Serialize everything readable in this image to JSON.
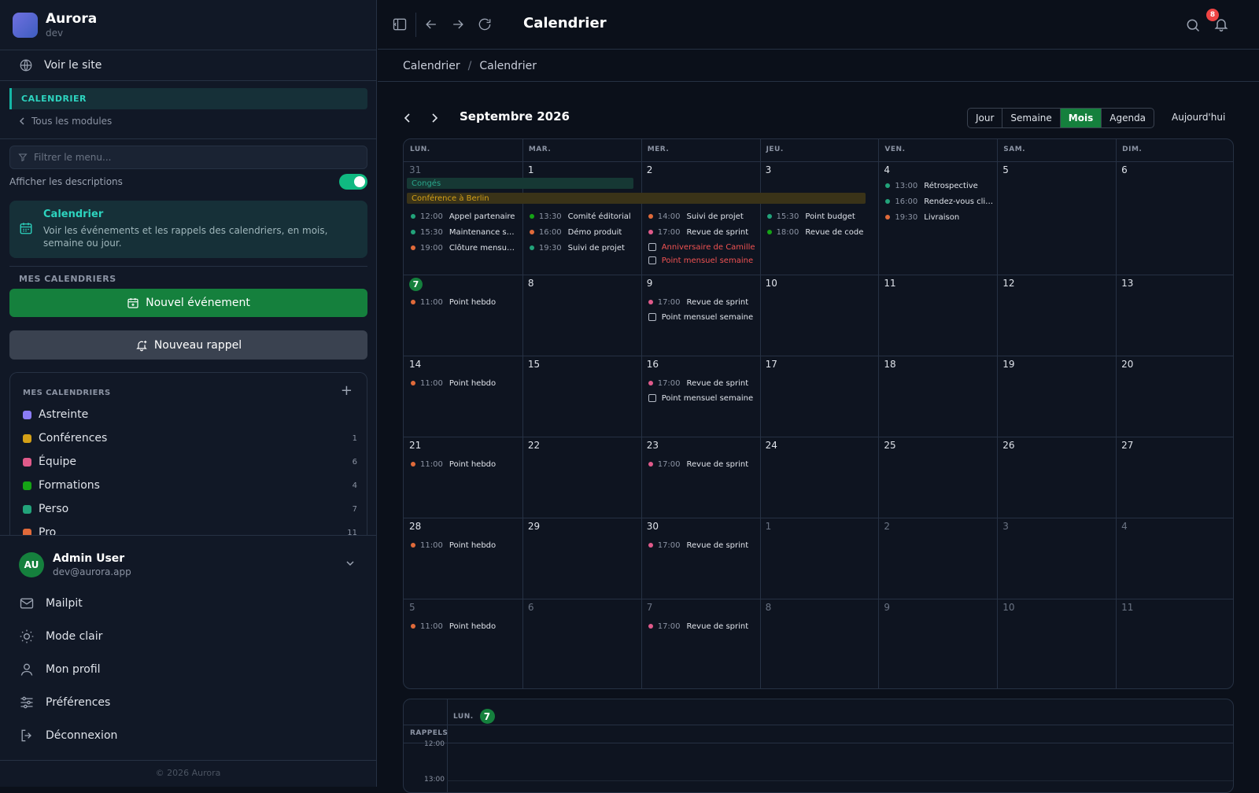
{
  "app": {
    "name": "Aurora",
    "env": "dev"
  },
  "sidebar": {
    "view_site": "Voir le site",
    "module": "CALENDRIER",
    "all_modules": "Tous les modules",
    "filter_placeholder": "Filtrer le menu...",
    "show_descriptions": "Afficher les descriptions",
    "show_descriptions_on": true,
    "desc_title": "Calendrier",
    "desc_text": "Voir les événements et les rappels des calendriers, en mois, semaine ou jour.",
    "section_label": "MES CALENDRIERS",
    "new_event": "Nouvel événement",
    "new_reminder": "Nouveau rappel",
    "calendars_header": "MES CALENDRIERS",
    "calendars": [
      {
        "name": "Astreinte",
        "color": "#8b7cf6",
        "count": ""
      },
      {
        "name": "Conférences",
        "color": "#d4a017",
        "count": "1"
      },
      {
        "name": "Équipe",
        "color": "#e05a8a",
        "count": "6"
      },
      {
        "name": "Formations",
        "color": "#15a315",
        "count": "4"
      },
      {
        "name": "Perso",
        "color": "#22a37a",
        "count": "7"
      },
      {
        "name": "Pro",
        "color": "#e06a3a",
        "count": "11"
      }
    ],
    "user": {
      "initials": "AU",
      "name": "Admin User",
      "email": "dev@aurora.app"
    },
    "menu": {
      "mailpit": "Mailpit",
      "light_mode": "Mode clair",
      "profile": "Mon profil",
      "preferences": "Préférences",
      "logout": "Déconnexion"
    },
    "footer": "© 2026 Aurora"
  },
  "topbar": {
    "title": "Calendrier",
    "notifications": "8"
  },
  "breadcrumb": {
    "root": "Calendrier",
    "current": "Calendrier"
  },
  "calendar": {
    "month": "Septembre 2026",
    "views": [
      "Jour",
      "Semaine",
      "Mois",
      "Agenda"
    ],
    "active_view": "Mois",
    "today_label": "Aujourd'hui",
    "day_headers": [
      "LUN.",
      "MAR.",
      "MER.",
      "JEU.",
      "VEN.",
      "SAM.",
      "DIM."
    ],
    "weeks": [
      [
        "31",
        "1",
        "2",
        "3",
        "4",
        "5",
        "6"
      ],
      [
        "7",
        "8",
        "9",
        "10",
        "11",
        "12",
        "13"
      ],
      [
        "14",
        "15",
        "16",
        "17",
        "18",
        "19",
        "20"
      ],
      [
        "21",
        "22",
        "23",
        "24",
        "25",
        "26",
        "27"
      ],
      [
        "28",
        "29",
        "30",
        "1",
        "2",
        "3",
        "4"
      ],
      [
        "5",
        "6",
        "7",
        "8",
        "9",
        "10",
        "11"
      ]
    ],
    "today": "7",
    "multi_day": {
      "conges": "Congés",
      "berlin": "Conférence à Berlin"
    },
    "events": {
      "w0": {
        "mon": [
          {
            "t": "12:00",
            "n": "Appel partenaire"
          },
          {
            "t": "15:30",
            "n": "Maintenance serveur"
          },
          {
            "t": "19:00",
            "n": "Clôture mensuelle"
          }
        ],
        "tue": [
          {
            "t": "13:30",
            "n": "Comité éditorial"
          },
          {
            "t": "16:00",
            "n": "Démo produit"
          },
          {
            "t": "19:30",
            "n": "Suivi de projet"
          }
        ],
        "wed": [
          {
            "t": "14:00",
            "n": "Suivi de projet"
          },
          {
            "t": "17:00",
            "n": "Revue de sprint"
          }
        ],
        "wed_rem": [
          "Anniversaire de Camille",
          "Point mensuel semaine"
        ],
        "thu": [
          {
            "t": "15:30",
            "n": "Point budget"
          },
          {
            "t": "18:00",
            "n": "Revue de code"
          }
        ],
        "fri": [
          {
            "t": "13:00",
            "n": "Rétrospective"
          },
          {
            "t": "16:00",
            "n": "Rendez-vous client"
          },
          {
            "t": "19:30",
            "n": "Livraison"
          }
        ]
      },
      "weekly_mon": {
        "t": "11:00",
        "n": "Point hebdo"
      },
      "weekly_wed": {
        "t": "17:00",
        "n": "Revue de sprint"
      },
      "weekly_wed_rem": "Point mensuel semaine"
    }
  },
  "week_view": {
    "day_label": "LUN.",
    "day_num": "7",
    "reminders": "RAPPELS",
    "times": [
      "12:00",
      "13:00"
    ]
  }
}
